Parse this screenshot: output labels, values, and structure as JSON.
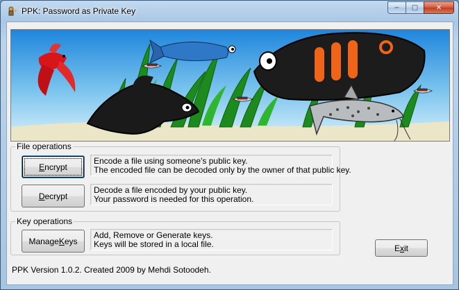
{
  "window": {
    "title": "PPK: Password as Private Key",
    "app_icon": "key-person-icon",
    "caption_buttons": {
      "minimize": "−",
      "maximize": "□",
      "close": "✕"
    }
  },
  "banner": {
    "image": "aquarium-fish-illustration"
  },
  "file_operations": {
    "label": "File operations",
    "encrypt": {
      "label_pre": "",
      "label_mnemonic": "E",
      "label_post": "ncrypt",
      "desc_line1": "Encode a file using someone's public key.",
      "desc_line2": "The encoded file can be decoded only by the owner of that public key."
    },
    "decrypt": {
      "label_pre": "",
      "label_mnemonic": "D",
      "label_post": "ecrypt",
      "desc_line1": "Decode a file encoded by your public key.",
      "desc_line2": "Your password is needed for this operation."
    }
  },
  "key_operations": {
    "label": "Key operations",
    "manage": {
      "label_pre": "Manage ",
      "label_mnemonic": "K",
      "label_post": "eys",
      "desc_line1": "Add, Remove or Generate keys.",
      "desc_line2": "Keys will be stored in a local file."
    }
  },
  "exit": {
    "label_pre": "E",
    "label_mnemonic": "x",
    "label_post": "it"
  },
  "footer": "PPK Version 1.0.2. Created 2009 by Mehdi Sotoodeh.",
  "colors": {
    "client_bg": "#f0f0f0",
    "water_top": "#2a8fe0",
    "water_bottom": "#bfe6f7",
    "sand": "#ece6c9",
    "focus_border": "#3c7fb1"
  }
}
